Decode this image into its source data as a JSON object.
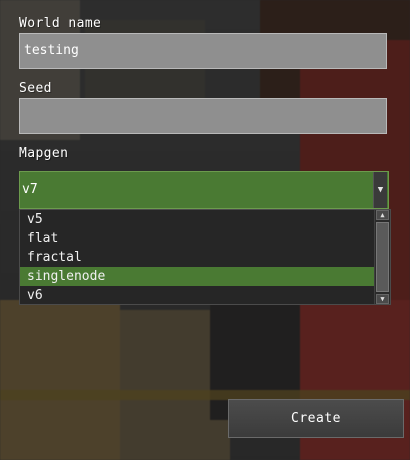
{
  "form": {
    "world_name_label": "World name",
    "world_name_value": "testing",
    "seed_label": "Seed",
    "seed_value": "",
    "mapgen_label": "Mapgen",
    "mapgen_selected": "v7"
  },
  "dropdown": {
    "items": [
      {
        "label": "v5",
        "selected": false
      },
      {
        "label": "flat",
        "selected": false
      },
      {
        "label": "fractal",
        "selected": false
      },
      {
        "label": "singlenode",
        "selected": true
      },
      {
        "label": "v6",
        "selected": false
      }
    ]
  },
  "actions": {
    "create_label": "Create"
  },
  "colors": {
    "accent": "#4a7a33",
    "field_bg": "#8f8f8f",
    "dropdown_bg": "#262626"
  },
  "icons": {
    "dropdown_arrow": "chevron-down-icon",
    "scroll_up": "chevron-up-icon",
    "scroll_down": "chevron-down-icon"
  }
}
